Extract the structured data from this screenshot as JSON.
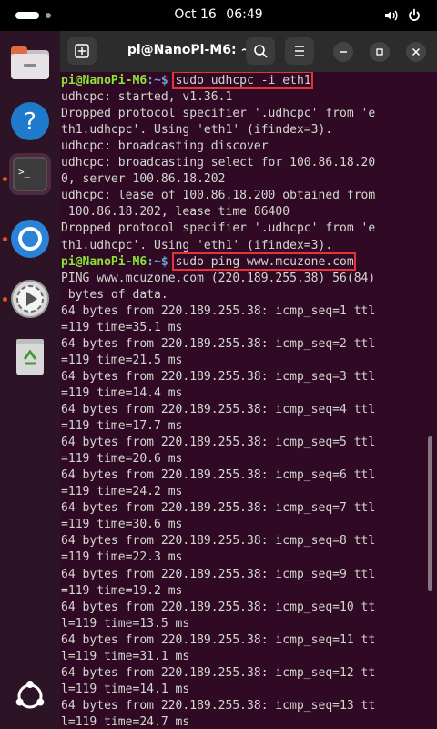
{
  "topbar": {
    "date": "Oct 16",
    "time": "06:49"
  },
  "dock": {
    "items": [
      {
        "name": "files",
        "icon": "folder-icon"
      },
      {
        "name": "help",
        "icon": "help-icon",
        "glyph": "?"
      },
      {
        "name": "terminal",
        "icon": "terminal-icon",
        "glyph": ">_",
        "running": true
      },
      {
        "name": "chromium",
        "icon": "chromium-icon",
        "running": true
      },
      {
        "name": "video-player",
        "icon": "video-player-icon",
        "running": true
      },
      {
        "name": "trash",
        "icon": "trash-icon"
      },
      {
        "name": "show-apps",
        "icon": "ubuntu-logo-icon"
      }
    ]
  },
  "window": {
    "title": "pi@NanoPi-M6: ~"
  },
  "terminal": {
    "prompt_user": "pi@NanoPi-M6",
    "prompt_sep": ":~$ ",
    "lines": [
      {
        "type": "prompt",
        "command": "sudo udhcpc -i eth1"
      },
      {
        "type": "out",
        "text": "udhcpc: started, v1.36.1"
      },
      {
        "type": "out",
        "text": "Dropped protocol specifier '.udhcpc' from 'e"
      },
      {
        "type": "out",
        "text": "th1.udhcpc'. Using 'eth1' (ifindex=3)."
      },
      {
        "type": "out",
        "text": "udhcpc: broadcasting discover"
      },
      {
        "type": "out",
        "text": "udhcpc: broadcasting select for 100.86.18.20"
      },
      {
        "type": "out",
        "text": "0, server 100.86.18.202"
      },
      {
        "type": "out",
        "text": "udhcpc: lease of 100.86.18.200 obtained from"
      },
      {
        "type": "out",
        "text": " 100.86.18.202, lease time 86400"
      },
      {
        "type": "out",
        "text": "Dropped protocol specifier '.udhcpc' from 'e"
      },
      {
        "type": "out",
        "text": "th1.udhcpc'. Using 'eth1' (ifindex=3)."
      },
      {
        "type": "prompt",
        "command": "sudo ping www.mcuzone.com"
      },
      {
        "type": "out",
        "text": "PING www.mcuzone.com (220.189.255.38) 56(84)"
      },
      {
        "type": "out",
        "text": " bytes of data."
      },
      {
        "type": "out",
        "text": "64 bytes from 220.189.255.38: icmp_seq=1 ttl"
      },
      {
        "type": "out",
        "text": "=119 time=35.1 ms"
      },
      {
        "type": "out",
        "text": "64 bytes from 220.189.255.38: icmp_seq=2 ttl"
      },
      {
        "type": "out",
        "text": "=119 time=21.5 ms"
      },
      {
        "type": "out",
        "text": "64 bytes from 220.189.255.38: icmp_seq=3 ttl"
      },
      {
        "type": "out",
        "text": "=119 time=14.4 ms"
      },
      {
        "type": "out",
        "text": "64 bytes from 220.189.255.38: icmp_seq=4 ttl"
      },
      {
        "type": "out",
        "text": "=119 time=17.7 ms"
      },
      {
        "type": "out",
        "text": "64 bytes from 220.189.255.38: icmp_seq=5 ttl"
      },
      {
        "type": "out",
        "text": "=119 time=20.6 ms"
      },
      {
        "type": "out",
        "text": "64 bytes from 220.189.255.38: icmp_seq=6 ttl"
      },
      {
        "type": "out",
        "text": "=119 time=24.2 ms"
      },
      {
        "type": "out",
        "text": "64 bytes from 220.189.255.38: icmp_seq=7 ttl"
      },
      {
        "type": "out",
        "text": "=119 time=30.6 ms"
      },
      {
        "type": "out",
        "text": "64 bytes from 220.189.255.38: icmp_seq=8 ttl"
      },
      {
        "type": "out",
        "text": "=119 time=22.3 ms"
      },
      {
        "type": "out",
        "text": "64 bytes from 220.189.255.38: icmp_seq=9 ttl"
      },
      {
        "type": "out",
        "text": "=119 time=19.2 ms"
      },
      {
        "type": "out",
        "text": "64 bytes from 220.189.255.38: icmp_seq=10 tt"
      },
      {
        "type": "out",
        "text": "l=119 time=13.5 ms"
      },
      {
        "type": "out",
        "text": "64 bytes from 220.189.255.38: icmp_seq=11 tt"
      },
      {
        "type": "out",
        "text": "l=119 time=31.1 ms"
      },
      {
        "type": "out",
        "text": "64 bytes from 220.189.255.38: icmp_seq=12 tt"
      },
      {
        "type": "out",
        "text": "l=119 time=14.1 ms"
      },
      {
        "type": "out",
        "text": "64 bytes from 220.189.255.38: icmp_seq=13 tt"
      },
      {
        "type": "out",
        "text": "l=119 time=24.7 ms"
      }
    ]
  },
  "colors": {
    "terminal_bg": "#300a24",
    "prompt_user": "#8ae234",
    "prompt_path": "#729fcf",
    "highlight_box": "#e8323a",
    "accent": "#e95420"
  }
}
